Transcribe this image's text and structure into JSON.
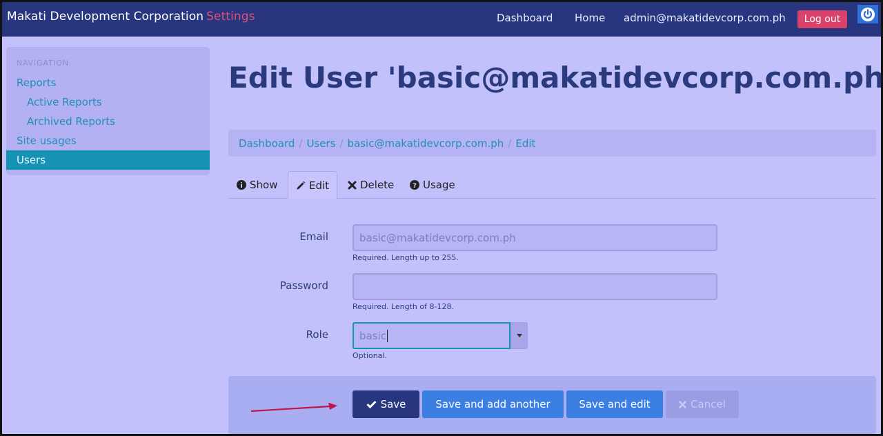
{
  "navbar": {
    "brand": "Makati Development Corporation",
    "brand_sub": "Settings",
    "links": [
      "Dashboard",
      "Home",
      "admin@makatidevcorp.com.ph"
    ],
    "logout": "Log out",
    "power_icon": "power-icon"
  },
  "sidebar": {
    "header": "NAVIGATION",
    "items": [
      {
        "label": "Reports"
      },
      {
        "label": "Active Reports"
      },
      {
        "label": "Archived Reports"
      },
      {
        "label": "Site usages"
      },
      {
        "label": "Users"
      }
    ]
  },
  "page": {
    "title": "Edit User 'basic@makatidevcorp.com.ph'"
  },
  "breadcrumb": [
    "Dashboard",
    "Users",
    "basic@makatidevcorp.com.ph",
    "Edit"
  ],
  "tabs": [
    {
      "label": "Show",
      "icon": "info-icon"
    },
    {
      "label": "Edit",
      "icon": "pencil-icon"
    },
    {
      "label": "Delete",
      "icon": "x-icon"
    },
    {
      "label": "Usage",
      "icon": "question-icon"
    }
  ],
  "form": {
    "email_label": "Email",
    "email_value": "basic@makatidevcorp.com.ph",
    "email_help": "Required. Length up to 255.",
    "password_label": "Password",
    "password_value": "",
    "password_help": "Required. Length of 8-128.",
    "role_label": "Role",
    "role_value": "basic",
    "role_help": "Optional."
  },
  "actions": {
    "save": "Save",
    "save_add": "Save and add another",
    "save_edit": "Save and edit",
    "cancel": "Cancel"
  },
  "colors": {
    "navbar": "#27367f",
    "background": "#c3c1fb",
    "accent": "#1592b4",
    "logout": "#d9436b",
    "primary_button": "#3b7fe2",
    "annotation_arrow": "#c0154a"
  }
}
